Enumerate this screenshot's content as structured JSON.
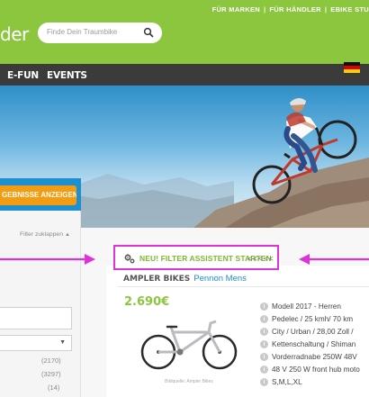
{
  "header": {
    "logo_text": "der",
    "top_links": [
      "FÜR MARKEN",
      "FÜR HÄNDLER",
      "EBIKE STU"
    ],
    "search_placeholder": "Finde Dein Traumbike"
  },
  "nav": {
    "items": [
      "E-FUN",
      "EVENTS"
    ],
    "language": "German"
  },
  "sidebar": {
    "results_button": "GEBNISSE ANZEIGEN",
    "collapse_label": "Filter zuklappen",
    "counts": [
      "(2170)",
      "(3297)",
      "(14)"
    ]
  },
  "main": {
    "filter_assistant_label": "NEU! FILTER ASSISTENT STARTEN",
    "filter_arrows": "<<<<<",
    "bike": {
      "brand": "AMPLER BIKES",
      "model": "Pennon Mens",
      "price": "2.690€",
      "image_credit": "Bildquelle: Ampler Bikes",
      "specs": [
        "Modell 2017 - Herren",
        "Pedelec / 25 kmh/ 70 km",
        "City / Urban / 28,00 Zoll /",
        "Kettenschaltung / Shiman",
        "Vorderradnabe 250W 48V",
        "48 V 250 W front hub moto",
        "S,M,L,XL"
      ]
    }
  },
  "colors": {
    "brand_green": "#8cc63f",
    "nav_dark": "#3b3b3b",
    "accent_orange": "#f39c12",
    "highlight_magenta": "#e033d6",
    "link_blue": "#1e8fd0"
  }
}
